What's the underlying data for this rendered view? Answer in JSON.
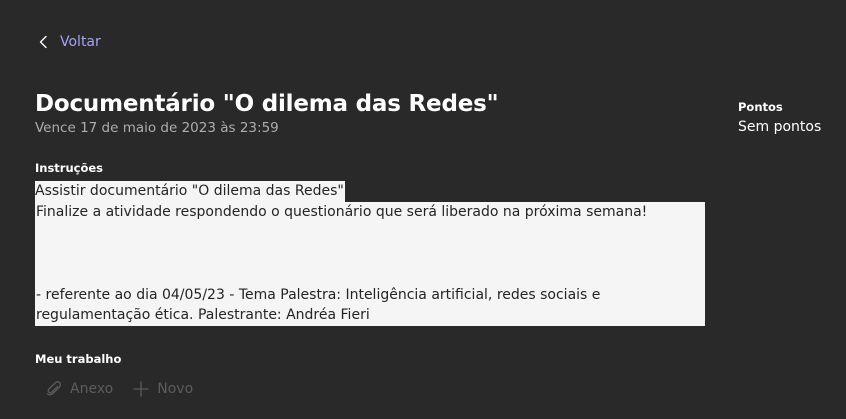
{
  "header": {
    "back_label": "Voltar"
  },
  "assignment": {
    "title": "Documentário \"O dilema das Redes\"",
    "due": "Vence 17 de maio de 2023 às 23:59"
  },
  "points": {
    "label": "Pontos",
    "value": "Sem pontos"
  },
  "instructions": {
    "label": "Instruções",
    "line1": "Assistir documentário \"O dilema das Redes\"",
    "line2": "Finalize a atividade respondendo o questionário que será liberado na próxima semana!",
    "line3": "- referente ao dia 04/05/23 - Tema Palestra: Inteligência artificial, redes sociais e regulamentação ética. Palestrante: Andréa Fieri"
  },
  "my_work": {
    "label": "Meu trabalho",
    "attach_label": "Anexo",
    "new_label": "Novo"
  },
  "colors": {
    "background": "#292929",
    "accent": "#a4a3f4",
    "instructions_bg": "#f5f5f5",
    "disabled": "#5c5c5c"
  }
}
